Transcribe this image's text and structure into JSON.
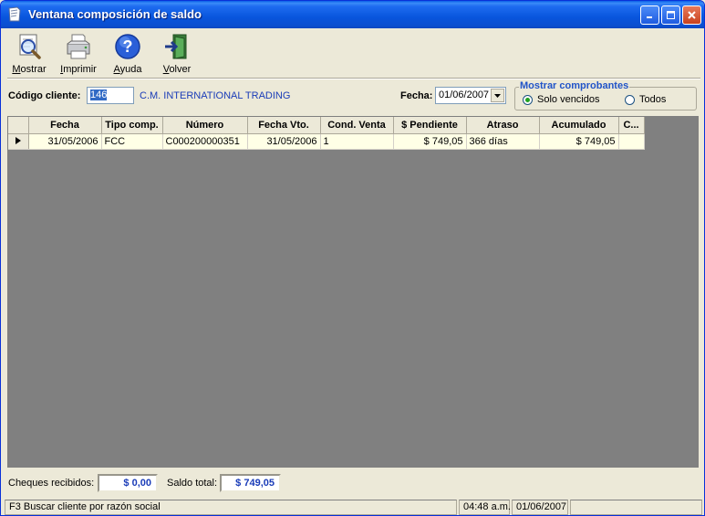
{
  "window": {
    "title": "Ventana composición de saldo",
    "accent": "#0A5FE8"
  },
  "toolbar": {
    "items": [
      {
        "label": "Mostrar",
        "icon": "magnifier-document-icon"
      },
      {
        "label": "Imprimir",
        "icon": "printer-icon"
      },
      {
        "label": "Ayuda",
        "icon": "help-icon"
      },
      {
        "label": "Volver",
        "icon": "exit-door-icon"
      }
    ]
  },
  "filters": {
    "client_label": "Código cliente:",
    "client_code": "146",
    "client_name": "C.M. INTERNATIONAL TRADING",
    "date_label": "Fecha:",
    "date_value": "01/06/2007",
    "group_title": "Mostrar comprobantes",
    "option_overdue": "Solo vencidos",
    "option_all": "Todos",
    "selected": "Solo vencidos"
  },
  "table": {
    "columns": [
      "Fecha",
      "Tipo comp.",
      "Número",
      "Fecha Vto.",
      "Cond. Venta",
      "$ Pendiente",
      "Atraso",
      "Acumulado",
      "C..."
    ],
    "rows": [
      {
        "fecha": "31/05/2006",
        "tipo": "FCC",
        "numero": "C000200000351",
        "vto": "31/05/2006",
        "cond": "1",
        "pendiente": "$ 749,05",
        "atraso": "366 días",
        "acumulado": "$ 749,05",
        "c": ""
      }
    ]
  },
  "summary": {
    "cheques_label": "Cheques recibidos:",
    "cheques_value": "$ 0,00",
    "saldo_label": "Saldo total:",
    "saldo_value": "$ 749,05"
  },
  "statusbar": {
    "hint": "F3 Buscar cliente por razón social",
    "time": "04:48 a.m.",
    "date": "01/06/2007"
  }
}
